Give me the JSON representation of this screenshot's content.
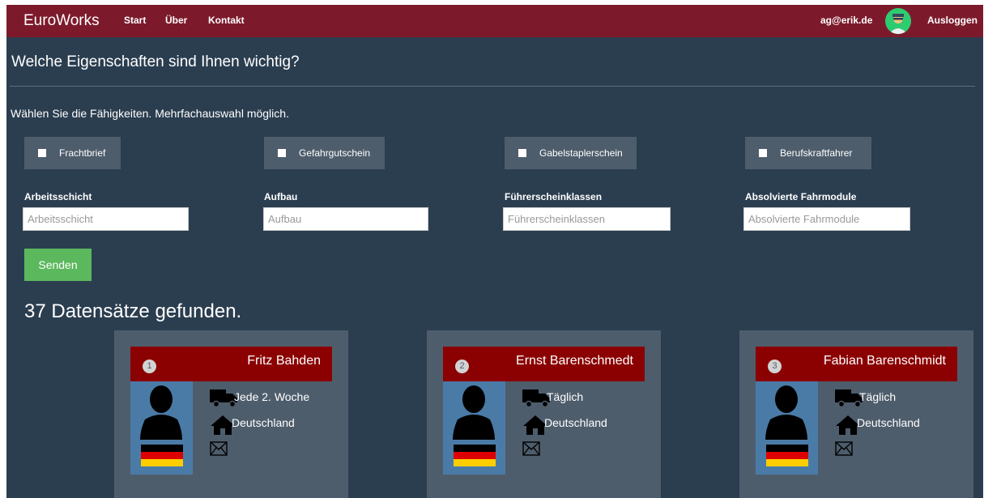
{
  "nav": {
    "brand": "EuroWorks",
    "links": [
      "Start",
      "Über",
      "Kontakt"
    ],
    "user_email": "ag@erik.de",
    "logout": "Ausloggen"
  },
  "heading": "Welche Eigenschaften sind Ihnen wichtig?",
  "subheading": "Wählen Sie die Fähigkeiten. Mehrfachauswahl möglich.",
  "skills": [
    {
      "label": "Frachtbrief",
      "checked": false
    },
    {
      "label": "Gefahrgutschein",
      "checked": false
    },
    {
      "label": "Gabelstaplerschein",
      "checked": false
    },
    {
      "label": "Berufskraftfahrer",
      "checked": false
    }
  ],
  "filters": [
    {
      "label": "Arbeitsschicht",
      "placeholder": "Arbeitsschicht"
    },
    {
      "label": "Aufbau",
      "placeholder": "Aufbau"
    },
    {
      "label": "Führerscheinklassen",
      "placeholder": "Führerscheinklassen"
    },
    {
      "label": "Absolvierte Fahrmodule",
      "placeholder": "Absolvierte Fahrmodule"
    }
  ],
  "submit_label": "Senden",
  "result_count": "37 Datensätze gefunden.",
  "results": [
    {
      "rank": "1",
      "name": "Fritz Bahden",
      "schedule": "Jede 2. Woche",
      "country": "Deutschland"
    },
    {
      "rank": "2",
      "name": "Ernst Barenschmedt",
      "schedule": "Täglich",
      "country": "Deutschland"
    },
    {
      "rank": "3",
      "name": "Fabian Barenschmidt",
      "schedule": "Täglich",
      "country": "Deutschland"
    }
  ],
  "icons": {
    "schedule": "truck-icon",
    "country": "house-icon",
    "contact": "envelope-icon",
    "flag": "german-flag-icon",
    "person": "person-silhouette-icon"
  },
  "colors": {
    "navbar": "#7c1a2c",
    "background": "#2b3e50",
    "panel": "#4e5d6c",
    "card_header": "#8b0000",
    "photo_bg": "#4a7ba7",
    "send_button": "#5cb85c"
  }
}
